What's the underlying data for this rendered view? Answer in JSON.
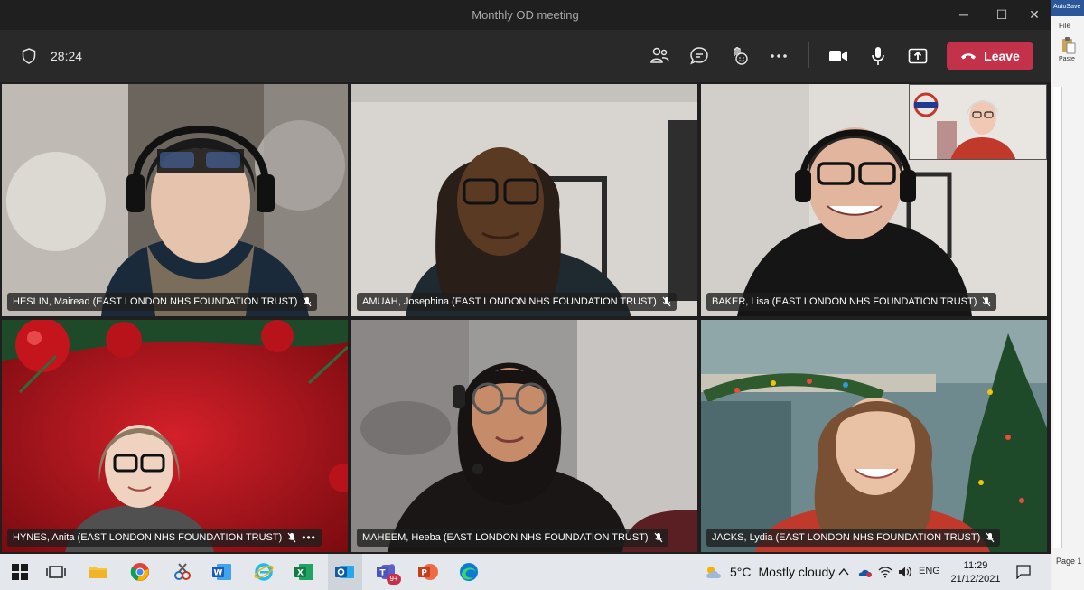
{
  "window": {
    "title": "Monthly OD meeting",
    "minimize_glyph": "─",
    "maximize_glyph": "☐",
    "close_glyph": "✕"
  },
  "toolbar": {
    "timer": "28:24",
    "leave_label": "Leave",
    "icons": [
      "shield-icon",
      "participants-icon",
      "chat-icon",
      "reactions-icon",
      "more-actions-icon",
      "camera-icon",
      "microphone-icon",
      "share-screen-icon",
      "phone-hangup-icon"
    ]
  },
  "participants": [
    {
      "name": "HESLIN, Mairead (EAST LONDON NHS FOUNDATION TRUST)"
    },
    {
      "name": "AMUAH, Josephina (EAST LONDON NHS FOUNDATION TRUST)"
    },
    {
      "name": "BAKER, Lisa (EAST LONDON NHS FOUNDATION TRUST)"
    },
    {
      "name": "HYNES, Anita (EAST LONDON NHS FOUNDATION TRUST)"
    },
    {
      "name": "MAHEEM, Heeba (EAST LONDON NHS FOUNDATION TRUST)"
    },
    {
      "name": "JACKS, Lydia (EAST LONDON NHS FOUNDATION TRUST)"
    }
  ],
  "more_glyph": "•••",
  "word": {
    "autosave": "AutoSave",
    "file": "File",
    "paste": "Paste",
    "page": "Page 1"
  },
  "taskbar": {
    "weather_temp": "5°C",
    "weather_desc": "Mostly cloudy",
    "teams_badge": "9+",
    "lang": "ENG",
    "time": "11:29",
    "date": "21/12/2021"
  },
  "colors": {
    "leave": "#c4314b",
    "toolbar": "#292929",
    "taskbar": "#e4e7ec"
  }
}
